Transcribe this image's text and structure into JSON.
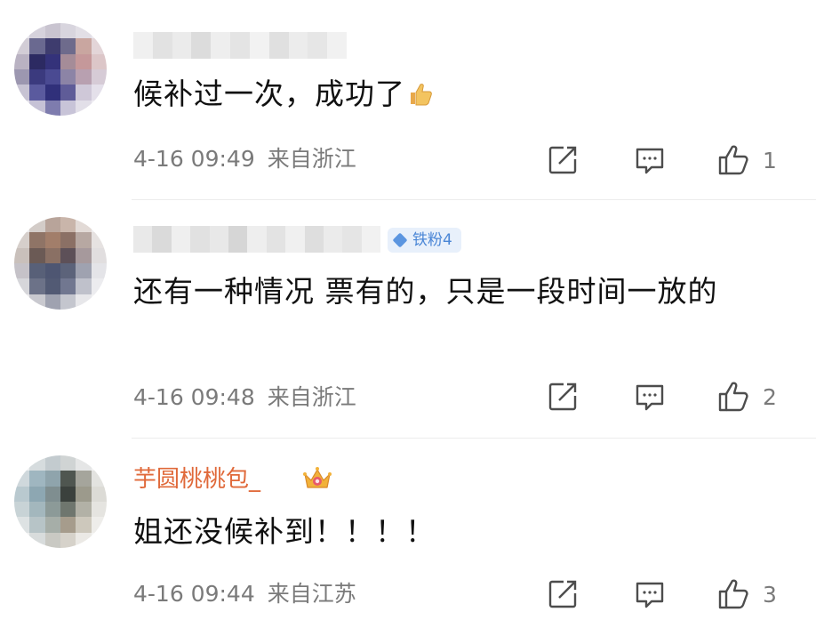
{
  "comments": [
    {
      "username_blurred": true,
      "badge": null,
      "text": "候补过一次，成功了",
      "emoji": "thumbs-up-emoji",
      "date": "4-16 09:49",
      "location": "来自浙江",
      "likes": "1"
    },
    {
      "username_blurred": true,
      "badge": "铁粉4",
      "text": "还有一种情况 票有的，只是一段时间一放的",
      "date": "4-16 09:48",
      "location": "来自浙江",
      "likes": "2"
    },
    {
      "username": "芋圆桃桃包_",
      "username_color": "#e0693a",
      "text": "姐还没候补到！！！！",
      "date": "4-16 09:44",
      "location": "来自江苏",
      "likes": "3"
    }
  ],
  "colors": {
    "meta_text": "#7a7a7a",
    "badge_bg": "#e8f0fb",
    "badge_text": "#4a86d6",
    "icon_stroke": "#4d4d4d"
  }
}
